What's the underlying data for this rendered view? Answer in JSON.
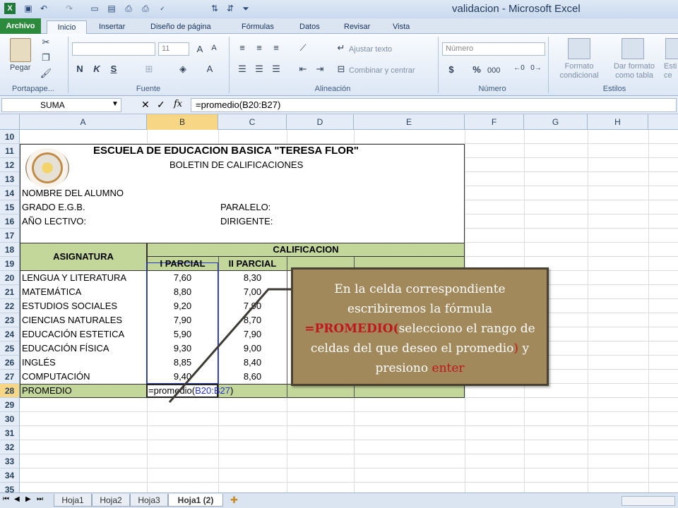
{
  "window": {
    "title": "validacion - Microsoft Excel"
  },
  "tabs": [
    "Archivo",
    "Inicio",
    "Insertar",
    "Diseño de página",
    "Fórmulas",
    "Datos",
    "Revisar",
    "Vista"
  ],
  "ribbon": {
    "groups": [
      "Portapape...",
      "Fuente",
      "Alineación",
      "Número",
      "Estilos"
    ],
    "paste_label": "Pegar",
    "font_size": "11",
    "bold": "N",
    "italic": "K",
    "underline": "S",
    "wrap_text": "Ajustar texto",
    "merge_center": "Combinar y centrar",
    "number_format": "Número",
    "currency": "$",
    "percent": "%",
    "thousands": "000",
    "cond_format": [
      "Formato",
      "condicional"
    ],
    "format_table": [
      "Dar formato",
      "como tabla"
    ],
    "cell_styles": [
      "Esti",
      "ce"
    ]
  },
  "formula_bar": {
    "name_box": "SUMA",
    "fx": "fx",
    "formula": "=promedio(B20:B27)"
  },
  "columns": [
    "A",
    "B",
    "C",
    "D",
    "E",
    "F",
    "G",
    "H"
  ],
  "rows": [
    "10",
    "11",
    "12",
    "13",
    "14",
    "15",
    "16",
    "17",
    "18",
    "19",
    "20",
    "21",
    "22",
    "23",
    "24",
    "25",
    "26",
    "27",
    "28",
    "29",
    "30",
    "31",
    "32",
    "33",
    "34",
    "35"
  ],
  "report": {
    "school": "ESCUELA DE EDUCACION BASICA \"TERESA FLOR\"",
    "subtitle": "BOLETIN DE CALIFICACIONES",
    "student_label": "NOMBRE DEL ALUMNO",
    "grade_label": "GRADO E.G.B.",
    "parallel_label": "PARALELO:",
    "year_label": "AÑO LECTIVO:",
    "teacher_label": "DIRIGENTE:",
    "subject_header": "ASIGNATURA",
    "grades_header": "CALIFICACION",
    "period1": "I PARCIAL",
    "period2": "II PARCIAL",
    "subjects": [
      {
        "name": "LENGUA Y LITERATURA",
        "p1": "7,60",
        "p2": "8,30"
      },
      {
        "name": "MATEMÁTICA",
        "p1": "8,80",
        "p2": "7,00"
      },
      {
        "name": "ESTUDIOS SOCIALES",
        "p1": "9,20",
        "p2": "7,90"
      },
      {
        "name": "CIENCIAS NATURALES",
        "p1": "7,90",
        "p2": "8,70"
      },
      {
        "name": "EDUCACIÓN ESTETICA",
        "p1": "5,90",
        "p2": "7,90"
      },
      {
        "name": "EDUCACIÓN FÍSICA",
        "p1": "9,30",
        "p2": "9,00"
      },
      {
        "name": "INGLÉS",
        "p1": "8,85",
        "p2": "8,40"
      },
      {
        "name": "COMPUTACIÓN",
        "p1": "9,40",
        "p2": "8,60"
      }
    ],
    "average_label": "PROMEDIO",
    "average_formula_prefix": "=promedio(",
    "average_formula_range": "B20:B27",
    "average_formula_suffix": ")"
  },
  "sheets": [
    "Hoja1",
    "Hoja2",
    "Hoja3",
    "Hoja1 (2)"
  ],
  "callout": {
    "line1": "En la celda correspondiente escribiremos la fórmula",
    "formula": "=PROMEDIO(",
    "line2": "selecciono el rango de celdas del que deseo el promedio",
    "paren": ")",
    "line3": " y presiono ",
    "key": "enter"
  },
  "colors": {
    "header_green": "#c4d79b",
    "archivo_green": "#2c8a3c",
    "callout_bg": "#a2895b",
    "accent_red": "#c0161c",
    "range_blue": "#2233cc"
  }
}
